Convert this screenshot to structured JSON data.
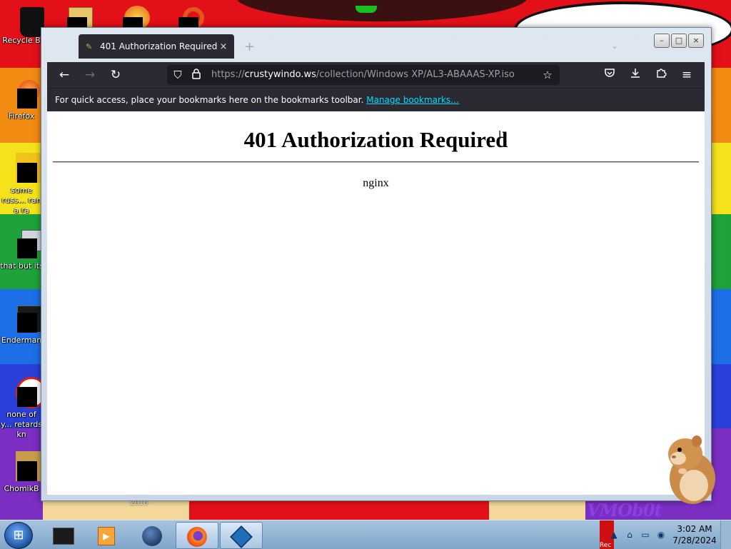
{
  "desktop": {
    "icons": [
      {
        "label": "Recycle B"
      },
      {
        "label": "Firefox"
      },
      {
        "label": "some russ... ran a ra"
      },
      {
        "label": "that but its"
      },
      {
        "label": "Enderman"
      },
      {
        "label": "none of y... retards kn"
      },
      {
        "label": "ChomikB"
      }
    ],
    "wallpaper_text": "VMOb0t",
    "wallpaper_year": "2016"
  },
  "browser": {
    "tab": {
      "title": "401 Authorization Required",
      "close_icon": "×"
    },
    "new_tab_icon": "+",
    "list_tabs_icon": "⌄",
    "window_controls": {
      "minimize": "–",
      "maximize": "□",
      "close": "×"
    },
    "toolbar": {
      "back_icon": "←",
      "forward_icon": "→",
      "reload_icon": "↻",
      "url_prefix": "https://",
      "url_host": "crustywindo.ws",
      "url_path": "/collection/Windows XP/AL3-ABAAAS-XP.iso",
      "bookmark_star_icon": "☆",
      "pocket_icon": "◡",
      "downloads_icon": "⭳",
      "extensions_icon": "⧉",
      "menu_icon": "≡"
    },
    "bookmarks_bar": {
      "message": "For quick access, place your bookmarks here on the bookmarks toolbar.",
      "link": "Manage bookmarks…"
    },
    "page": {
      "heading": "401 Authorization Required",
      "server": "nginx"
    }
  },
  "taskbar": {
    "start_icon": "windows-logo",
    "items": [
      {
        "name": "terminal",
        "active": false
      },
      {
        "name": "media-player",
        "active": false
      },
      {
        "name": "globe",
        "active": false
      },
      {
        "name": "firefox",
        "active": true
      },
      {
        "name": "virtualbox",
        "active": true
      }
    ],
    "tray_label": "Rec",
    "clock": {
      "time": "3:02 AM",
      "date": "7/28/2024"
    }
  },
  "colors": {
    "browser_chrome": "#2b2a33",
    "url_field": "#1c1b22",
    "link": "#00ddff",
    "taskbar": "#a8c4df"
  }
}
